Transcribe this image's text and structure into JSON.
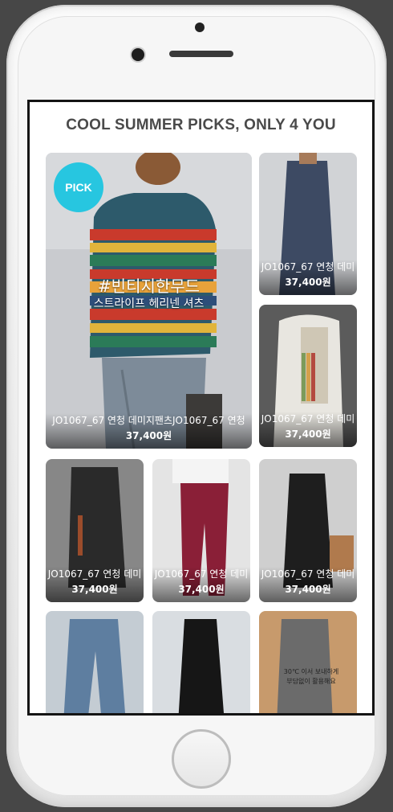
{
  "screen": {
    "headline": "COOL SUMMER PICKS, ONLY 4 YOU"
  },
  "featured": {
    "badge": "PICK",
    "overlay_title": "#빈티지한무드",
    "overlay_subtitle": "스트라이프 헤리넨 셔츠",
    "name": "JO1067_67 연청 데미지팬츠JO1067_67 연청",
    "price": "37,400원"
  },
  "products": [
    {
      "name": "JO1067_67 연청 데미",
      "price": "37,400원"
    },
    {
      "name": "JO1067_67 연청 데미",
      "price": "37,400원"
    },
    {
      "name": "JO1067_67 연청 데미",
      "price": "37,400원"
    },
    {
      "name": "JO1067_67 연청 데미",
      "price": "37,400원"
    },
    {
      "name": "JO1067_67 연청 데미",
      "price": "37,400원"
    }
  ],
  "partial_tile_caption": {
    "line1": "30℃ 이서 보내하게",
    "line2": "부담없이 활용해요"
  },
  "colors": {
    "device_body": "#f2f2f2",
    "screen_border": "#141414",
    "pick_badge": "#27c6e0",
    "headline_text": "#4a4a4a"
  }
}
